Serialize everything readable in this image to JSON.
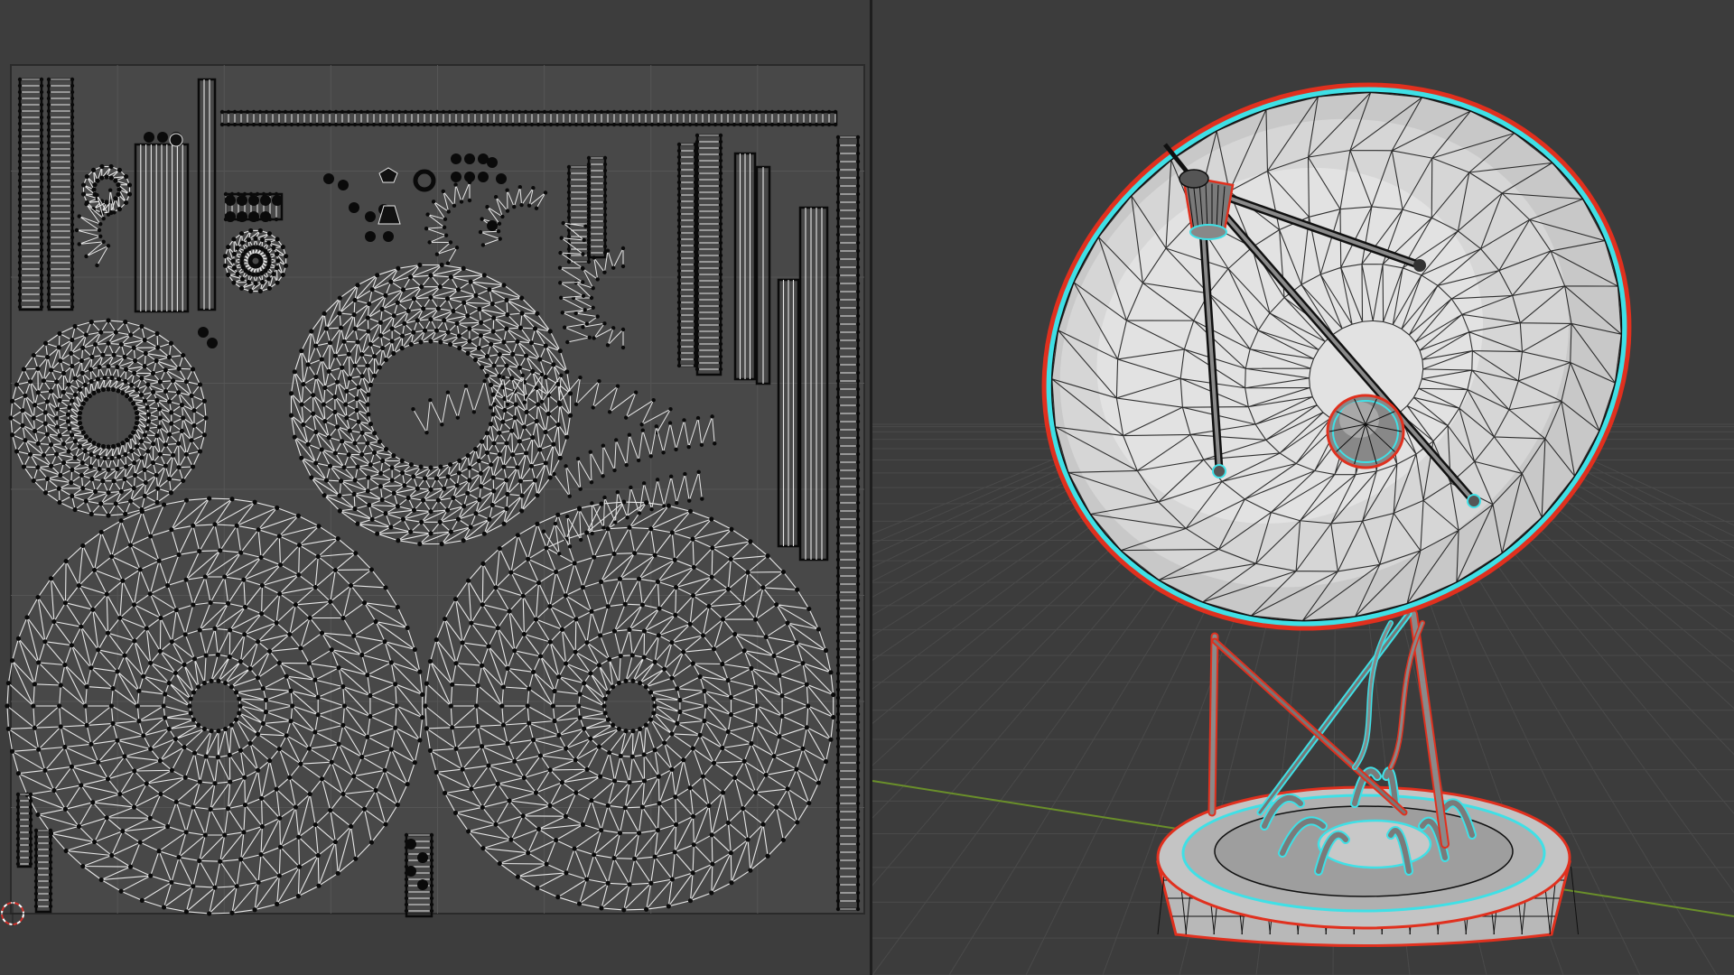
{
  "editors": {
    "uv_editor": {
      "name": "",
      "islands": [
        "large-disc-left",
        "large-disc-right",
        "ring-disc-left",
        "ring-disc-center",
        "strip-top",
        "strip-right",
        "arc-strips",
        "small-parts"
      ]
    },
    "viewport_3d": {
      "name": "",
      "object": "satellite-dish"
    }
  },
  "colors": {
    "uv_background": "#3d3d3d",
    "uv_bounds_fill": "#484848",
    "uv_grid": "#555555",
    "uv_wire": "#e8e8e8",
    "uv_vertex": "#0a0a0a",
    "viewport_background": "#3c3c3c",
    "viewport_grid": "#4a4a4a",
    "x_axis": "#9a3a3a",
    "y_axis": "#6a8f2a",
    "mesh_fill": "#bdbdbd",
    "mesh_wire": "#101010",
    "select_outline_red": "#e0301e",
    "select_outline_cyan": "#3fe0e6",
    "cursor_red": "#d0302a"
  },
  "icons": {
    "cursor": "3d-cursor-icon"
  }
}
